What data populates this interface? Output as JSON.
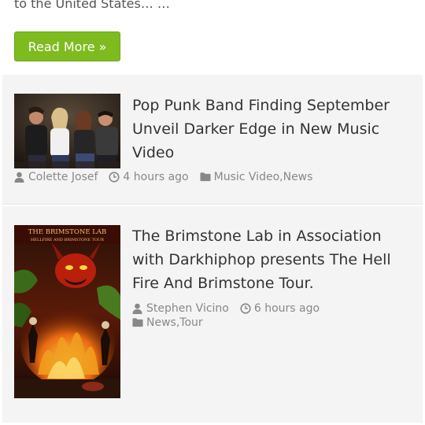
{
  "top_excerpt": {
    "text": "to the United States… …",
    "read_more_label": "Read More »"
  },
  "posts": [
    {
      "title": "Pop Punk Band Finding September Unveil Darker Edge in New Music Video",
      "author": "Colette Josef",
      "time": "4 hours ago",
      "categories": [
        "Music Video",
        "News"
      ],
      "separator": ", "
    },
    {
      "title": "The Brimstone Lab in Association with Darkhiphop presents The Hell Fire And Brimstone Tour.",
      "thumb_text_1": "THE BRIMSTONE LAB",
      "thumb_text_2": "HELLFIRE AND BRIMSTONE TOUR",
      "author": "Stephen Vicino",
      "time": "6 hours ago",
      "categories": [
        "News",
        "Tour"
      ],
      "separator": ", "
    }
  ],
  "colors": {
    "read_more_bg": "#7dbb1f",
    "card_bg": "#f4f4f4",
    "meta_text": "#888888"
  },
  "icons": {
    "author": "user-icon",
    "time": "clock-icon",
    "category": "folder-icon"
  }
}
